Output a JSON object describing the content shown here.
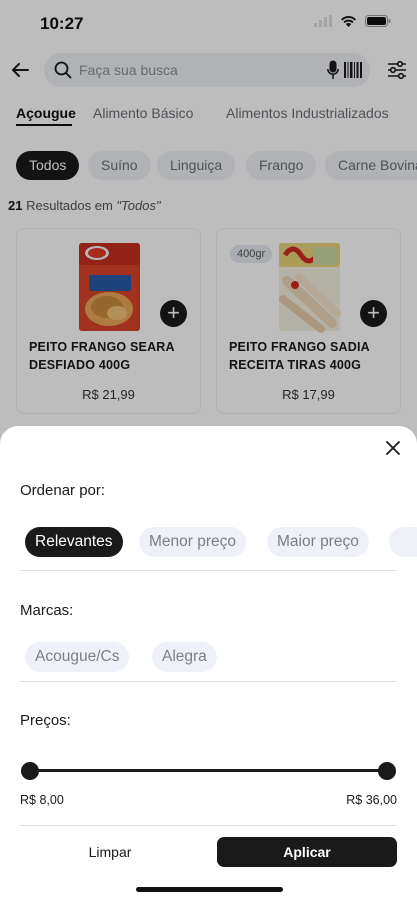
{
  "status_bar": {
    "time": "10:27"
  },
  "search": {
    "placeholder": "Faça sua busca"
  },
  "category_tabs": [
    {
      "label": "Açougue",
      "active": true
    },
    {
      "label": "Alimento Básico",
      "active": false
    },
    {
      "label": "Alimentos Industrializados",
      "active": false
    }
  ],
  "sub_chips": [
    {
      "label": "Todos",
      "active": true
    },
    {
      "label": "Suíno",
      "active": false
    },
    {
      "label": "Linguiça",
      "active": false
    },
    {
      "label": "Frango",
      "active": false
    },
    {
      "label": "Carne Bovina",
      "active": false
    }
  ],
  "results": {
    "count": "21",
    "text": " Resultados em ",
    "filter": "\"Todos\""
  },
  "products": [
    {
      "name": "PEITO FRANGO SEARA DESFIADO 400G",
      "price": "R$ 21,99",
      "badge": ""
    },
    {
      "name": "PEITO FRANGO SADIA RECEITA TIRAS 400G",
      "price": "R$ 17,99",
      "badge": "400gr"
    }
  ],
  "filter_sheet": {
    "sort": {
      "title": "Ordenar por:",
      "options": [
        {
          "label": "Relevantes",
          "active": true
        },
        {
          "label": "Menor preço",
          "active": false
        },
        {
          "label": "Maior preço",
          "active": false
        }
      ]
    },
    "brands": {
      "title": "Marcas:",
      "options": [
        {
          "label": "Acougue/Cs"
        },
        {
          "label": "Alegra"
        }
      ]
    },
    "prices": {
      "title": "Preços:",
      "min_label": "R$ 8,00",
      "max_label": "R$ 36,00",
      "selected_range_fraction": [
        0.0,
        1.0
      ]
    },
    "clear_label": "Limpar",
    "apply_label": "Aplicar"
  },
  "colors": {
    "accent": "#1a1a1a",
    "chip_bg": "#eef2f8",
    "overlay": "rgba(0,0,0,0.26)"
  }
}
